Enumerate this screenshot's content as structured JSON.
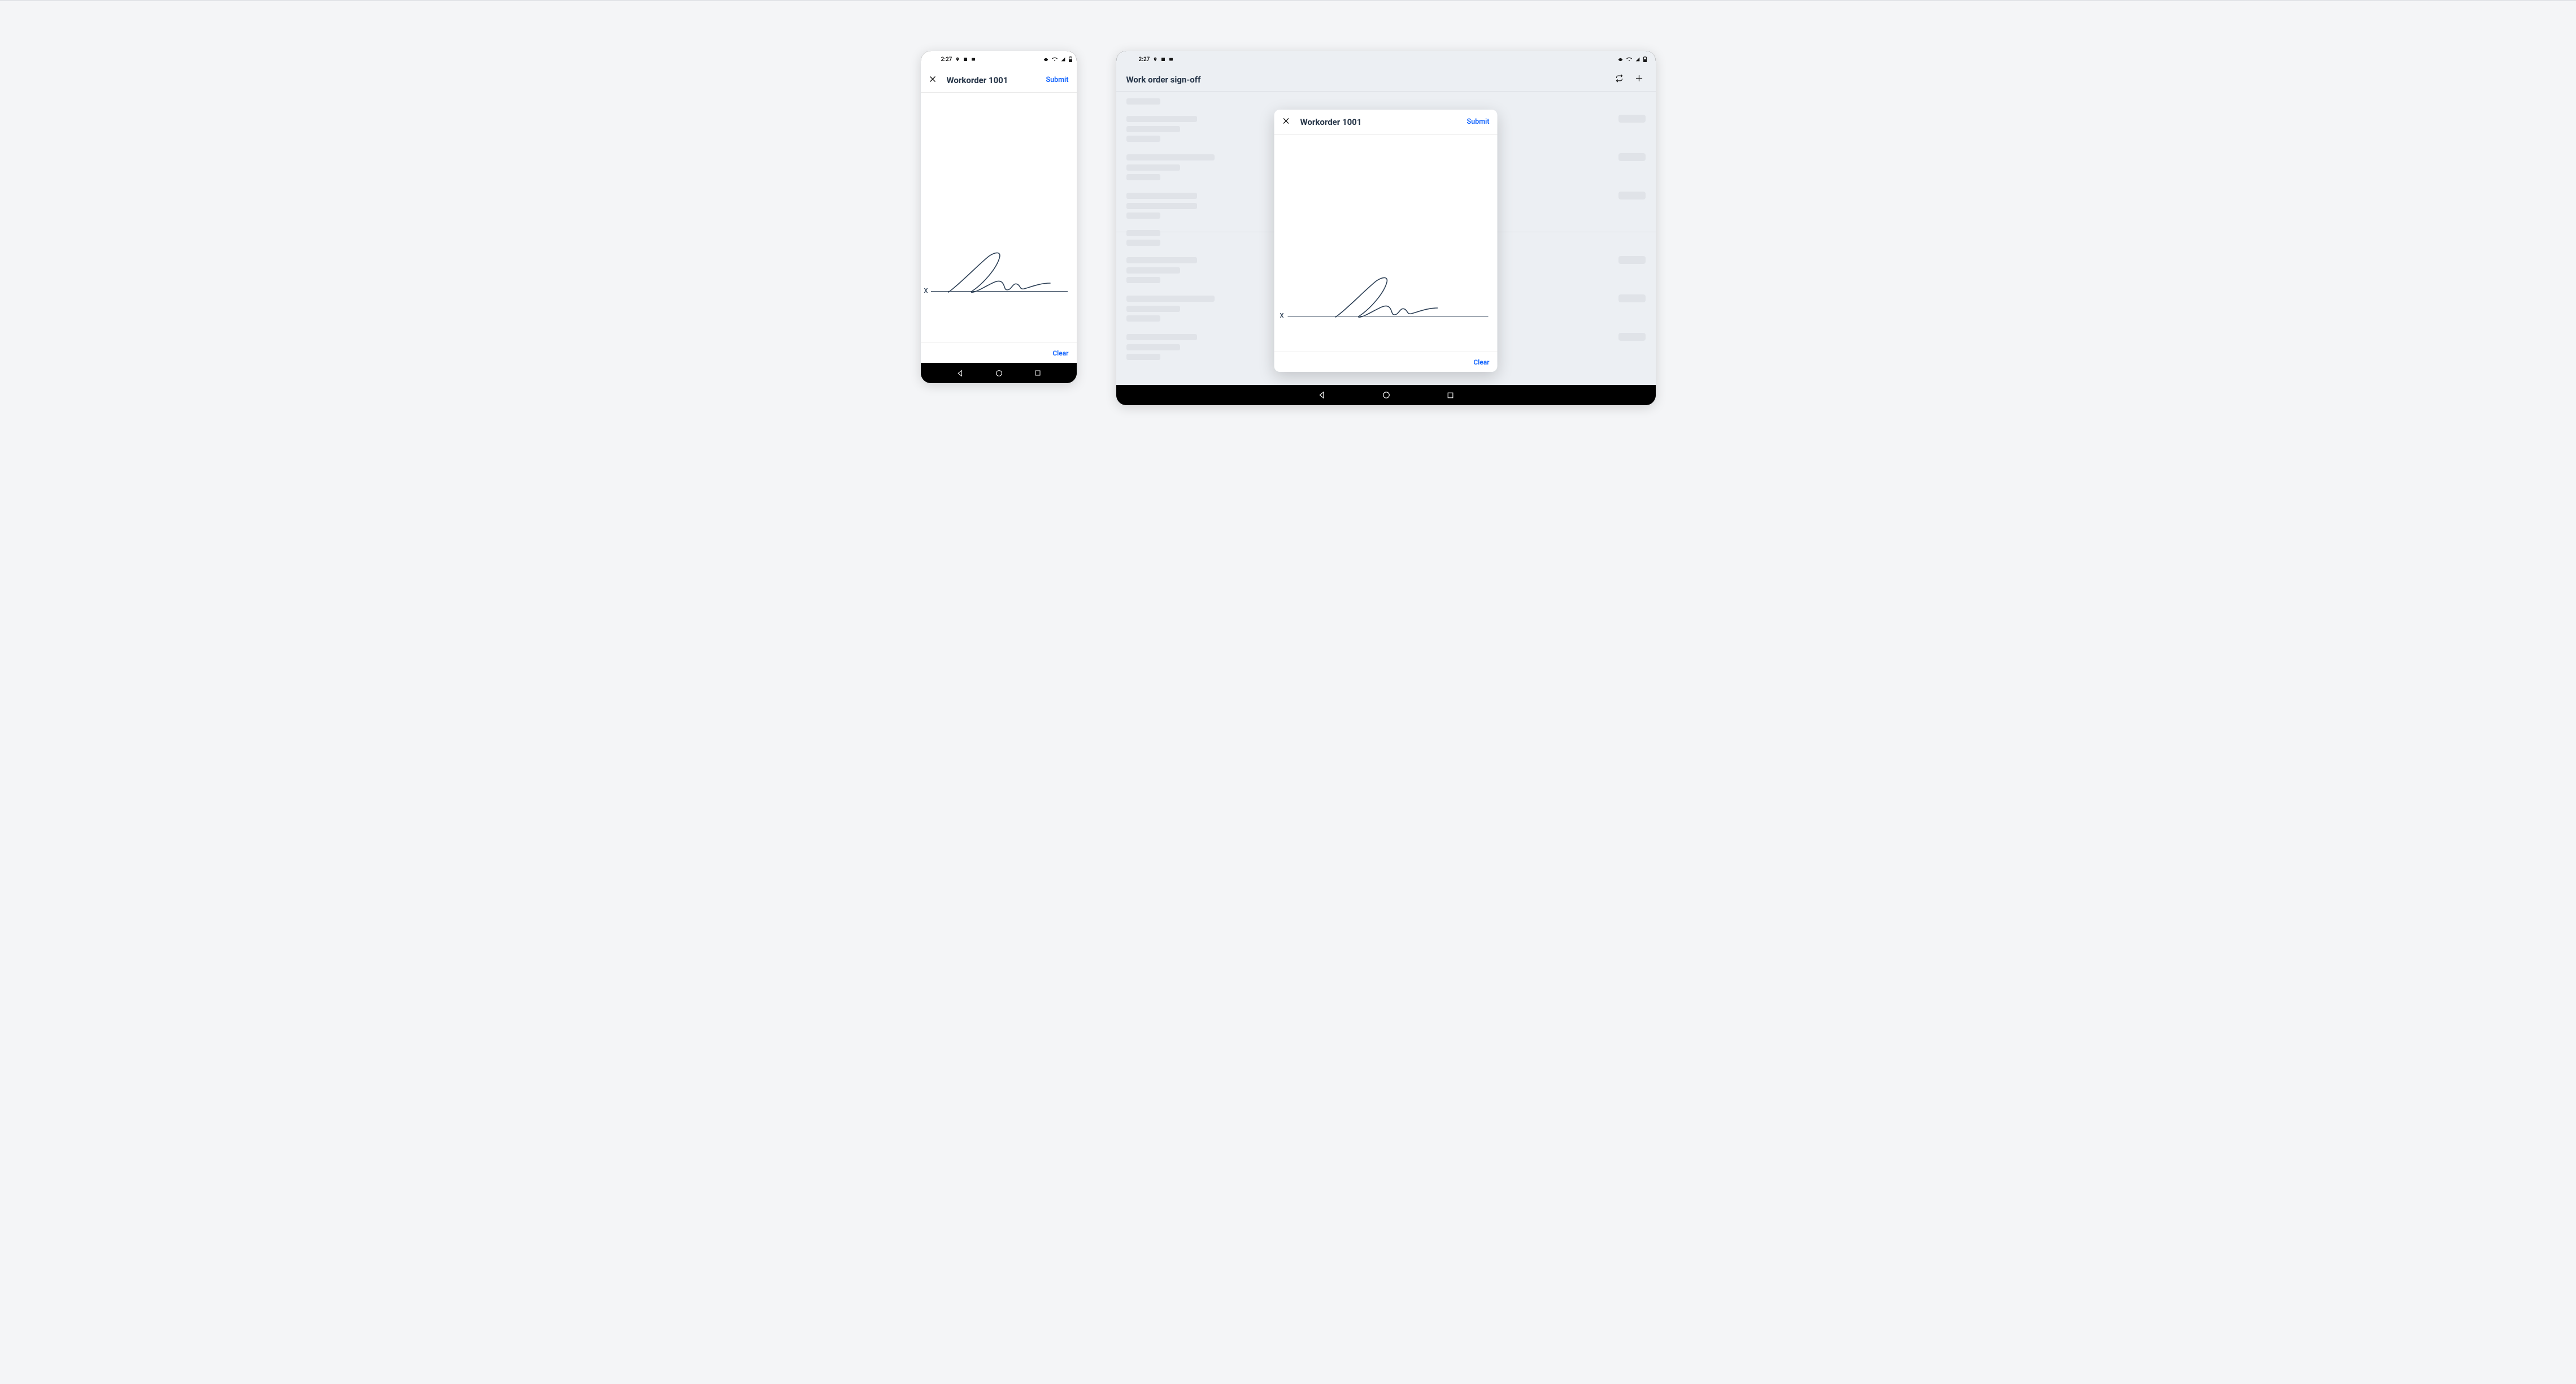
{
  "statusbar": {
    "time": "2:27"
  },
  "phone": {
    "title": "Workorder 1001",
    "submit_label": "Submit",
    "clear_label": "Clear",
    "sig_x": "X"
  },
  "tablet": {
    "page_title": "Work order sign-off",
    "modal": {
      "title": "Workorder 1001",
      "submit_label": "Submit",
      "clear_label": "Clear",
      "sig_x": "X"
    }
  }
}
